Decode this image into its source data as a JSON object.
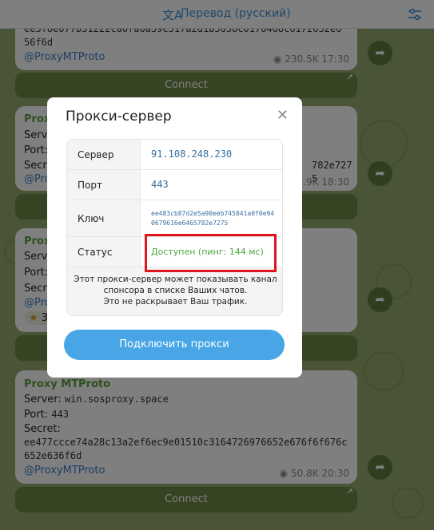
{
  "header": {
    "translate_icon": "translate-icon",
    "title": "Перевод (русский)",
    "filter_icon": "filter-settings-icon"
  },
  "messages": [
    {
      "hash": "ee5f8e077b51222ca0fa6a59c517a2d1b5658c0178468c6172652e656f6d",
      "channel": "@ProxyMTProto",
      "views": "230.5K",
      "time": "17:30",
      "connect_label": "Connect"
    },
    {
      "sender": "Proxy MTProto",
      "server_label": "Server:",
      "port_label": "Port:",
      "secret_label": "Secret:",
      "hash_tail": "782e7275",
      "channel": "@ProxyMTProto",
      "views_partial": ".9K",
      "time": "18:30"
    },
    {
      "sender": "Proxy MTProto",
      "server_label": "Server:",
      "port_label": "Port:",
      "secret_label": "Secret:",
      "channel": "@ProxyMTProto",
      "reaction_count": "3"
    },
    {
      "sender": "Proxy MTProto",
      "server_label": "Server:",
      "server": "win.sosproxy.space",
      "port_label": "Port:",
      "port": "443",
      "secret_label": "Secret:",
      "secret": "ee477ccce74a28c13a2ef6ec9e01510c3164726976652e676f6f676c652e636f6d",
      "channel": "@ProxyMTProto",
      "views": "50.8K",
      "time": "20:30",
      "connect_label": "Connect"
    }
  ],
  "dialog": {
    "title": "Прокси-сервер",
    "close_icon": "close-icon",
    "rows": {
      "server": {
        "label": "Сервер",
        "value": "91.108.248.230"
      },
      "port": {
        "label": "Порт",
        "value": "443"
      },
      "key": {
        "label": "Ключ",
        "value": "ee483cb87d2e5a90eeb745841a0f0e940679616e6465782e7275"
      },
      "status": {
        "label": "Статус",
        "value": "Доступен (пинг: 144 мс)"
      }
    },
    "note": {
      "line1": "Этот прокси-сервер может показывать канал",
      "line2": "спонсора в списке Ваших чатов.",
      "line3": "Это не раскрывает Ваш трафик."
    },
    "connect_button": "Подключить прокси"
  },
  "colors": {
    "accent": "#48a6e6",
    "status_ok": "#4da63f",
    "highlight": "#e0141c",
    "sender": "#5aa13e"
  }
}
